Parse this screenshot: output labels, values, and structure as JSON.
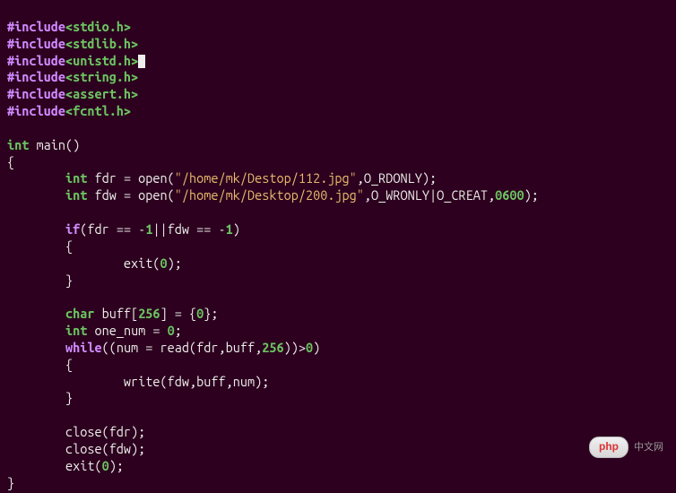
{
  "code": {
    "include_kw": "#include",
    "hdr1": "<stdio.h>",
    "hdr2": "<stdlib.h>",
    "hdr3": "<unistd.h>",
    "hdr4": "<string.h>",
    "hdr5": "<assert.h>",
    "hdr6": "<fcntl.h>",
    "type_int": "int",
    "type_char": "char",
    "main": " main()",
    "brace_open": "{",
    "brace_close": "}",
    "l_decl_fdr_a": " fdr = open(",
    "l_decl_fdr_str": "\"/home/mk/Destop/112.jpg\"",
    "l_decl_fdr_b": ",O_RDONLY);",
    "l_decl_fdw_a": " fdw = open(",
    "l_decl_fdw_str": "\"/home/mk/Desktop/200.jpg\"",
    "l_decl_fdw_b": ",O_WRONLY|O_CREAT,",
    "l_decl_fdw_num": "0600",
    "l_decl_fdw_c": ");",
    "kw_if": "if",
    "if_cond_a": "(fdr == -",
    "num1": "1",
    "if_cond_b": "||fdw == -",
    "if_cond_c": ")",
    "exit_call_a": "exit(",
    "num0": "0",
    "exit_call_b": ");",
    "buff_a": " buff[",
    "num256": "256",
    "buff_b": "] = {",
    "buff_c": "};",
    "one_num": " one_num = ",
    "one_num_end": ";",
    "kw_while": "while",
    "while_a": "((num = read(fdr,buff,",
    "while_b": "))>",
    "while_c": ")",
    "write_call": "write(fdw,buff,num);",
    "close_fdr": "close(fdr);",
    "close_fdw": "close(fdw);"
  },
  "badge": {
    "brand_a": "php",
    "brand_b": "中文网"
  }
}
